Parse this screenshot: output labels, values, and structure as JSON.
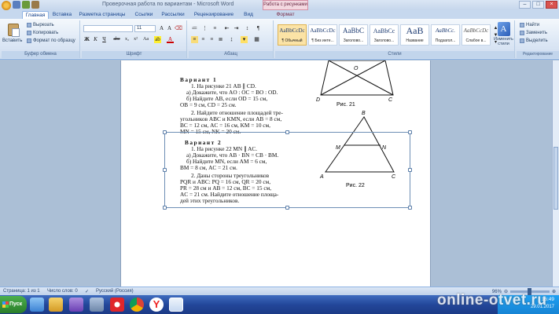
{
  "window": {
    "title": "Проверочная работа по вариантам - Microsoft Word",
    "context_tab_title": "Работа с рисунками",
    "controls": {
      "minimize": "–",
      "maximize": "□",
      "close": "×"
    }
  },
  "tabs": [
    {
      "label": "Главная",
      "active": true
    },
    {
      "label": "Вставка"
    },
    {
      "label": "Разметка страницы"
    },
    {
      "label": "Ссылки"
    },
    {
      "label": "Рассылки"
    },
    {
      "label": "Рецензирование"
    },
    {
      "label": "Вид"
    },
    {
      "label": "Формат",
      "contextual": true
    }
  ],
  "ribbon": {
    "clipboard": {
      "paste_label": "Вставить",
      "cut_label": "Вырезать",
      "copy_label": "Копировать",
      "format_painter_label": "Формат по образцу",
      "group_label": "Буфер обмена"
    },
    "font": {
      "font_name": "",
      "font_size": "11",
      "group_label": "Шрифт",
      "buttons": [
        "Ж",
        "К",
        "Ч",
        "abe",
        "x₂",
        "x²",
        "Aa",
        "A"
      ]
    },
    "paragraph": {
      "group_label": "Абзац"
    },
    "styles": {
      "group_label": "Стили",
      "items": [
        {
          "sample": "AaBbCcDc",
          "name": "¶ Обычный",
          "active": true
        },
        {
          "sample": "AaBbCcDc",
          "name": "¶ Без инте..."
        },
        {
          "sample": "AaBbC",
          "name": "Заголово..."
        },
        {
          "sample": "AaBbCc",
          "name": "Заголово..."
        },
        {
          "sample": "AaB",
          "name": "Название"
        },
        {
          "sample": "AaBbCc.",
          "name": "Подзагол..."
        },
        {
          "sample": "AaBbCcDc",
          "name": "Слабое в..."
        }
      ],
      "change_styles_label": "Изменить стили"
    },
    "editing": {
      "find_label": "Найти",
      "replace_label": "Заменить",
      "select_label": "Выделить",
      "group_label": "Редактирование"
    }
  },
  "document": {
    "variant1": {
      "heading": "Вариант 1",
      "lines": [
        "1. На рисунке 21 AB ∥ CD.",
        "а) Докажите, что AO : OC = BO : OD.",
        "б) Найдите AB, если OD = 15 см,",
        "OB = 9 см, CD = 25 см.",
        "2. Найдите отношение площадей тре-",
        "угольников ABC и KMN, если AB = 8 см,",
        "BC = 12 см, AC = 16 см, KM = 10 см,",
        "MN = 15 см, NK = 20 см."
      ]
    },
    "variant2": {
      "heading": "Вариант 2",
      "lines": [
        "1. На рисунке 22 MN ∥ AC.",
        "а) Докажите, что AB · BN = CB · BM.",
        "б) Найдите MN, если AM = 6 см,",
        "BM = 8 см, AC = 21 см.",
        "2. Даны стороны треугольников",
        "PQR и ABC: PQ = 16 см, QR = 20 см,",
        "PR = 28 см и AB = 12 см, BC = 15 см,",
        "AC = 21 см. Найдите отношение площа-",
        "дей этих треугольников."
      ]
    },
    "figure21": {
      "caption": "Рис. 21",
      "labels": {
        "O": "O",
        "D": "D",
        "C": "C"
      }
    },
    "figure22": {
      "caption": "Рис. 22",
      "labels": {
        "B": "B",
        "M": "M",
        "N": "N",
        "A": "A",
        "C": "C"
      }
    }
  },
  "statusbar": {
    "page": "Страница: 1 из 1",
    "words": "Число слов: 0",
    "language": "Русский (Россия)",
    "zoom": "96%"
  },
  "taskbar": {
    "start_label": "Пуск",
    "time": "16:49",
    "date": "29.01.2017"
  },
  "watermark": "online-otvet.ru"
}
